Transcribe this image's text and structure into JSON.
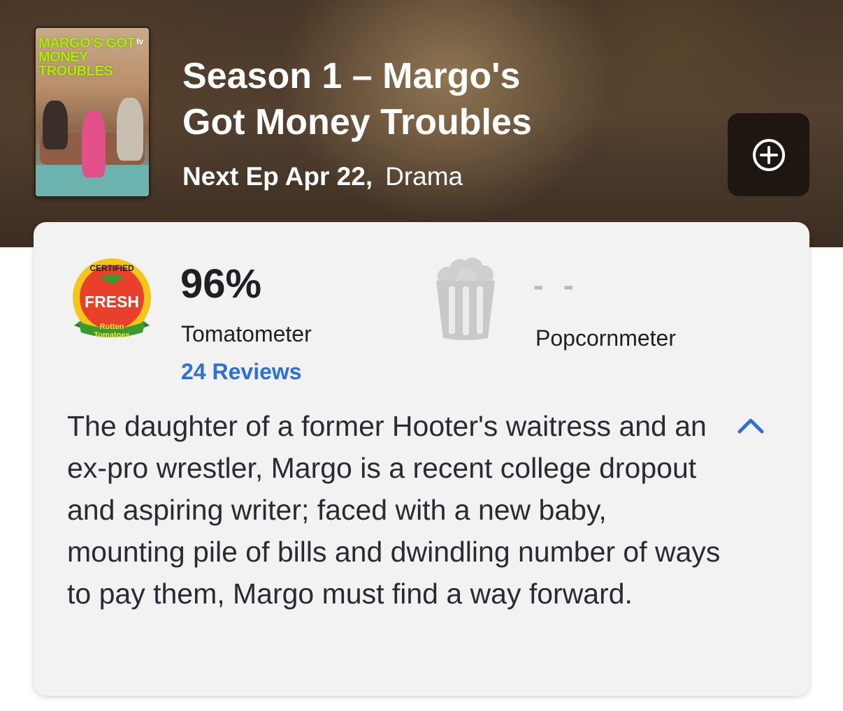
{
  "header": {
    "title": "Season 1 – Margo's Got Money Troubles",
    "next_episode": "Next Ep Apr 22,",
    "genre": "Drama",
    "poster_title": "MARGO'S GOT MONEY TROUBLES",
    "poster_badge": "tv"
  },
  "add_button": {
    "icon": "plus-circle-icon"
  },
  "tomatometer": {
    "badge_top": "CERTIFIED",
    "badge_main": "FRESH",
    "badge_brand_1": "Rotten",
    "badge_brand_2": "Tomatoes",
    "score": "96%",
    "label": "Tomatometer",
    "reviews": "24 Reviews"
  },
  "popcornmeter": {
    "score": "- -",
    "label": "Popcornmeter"
  },
  "synopsis": "The daughter of a former Hooter's waitress and an ex-pro wrestler, Margo is a recent college dropout and aspiring writer; faced with a new baby, mounting pile of bills and dwindling number of ways to pay them, Margo must find a way forward.",
  "colors": {
    "link": "#2f6fd6",
    "card": "#f2f2f2",
    "fresh_red": "#e8402b",
    "fresh_green": "#3a9a2f"
  }
}
